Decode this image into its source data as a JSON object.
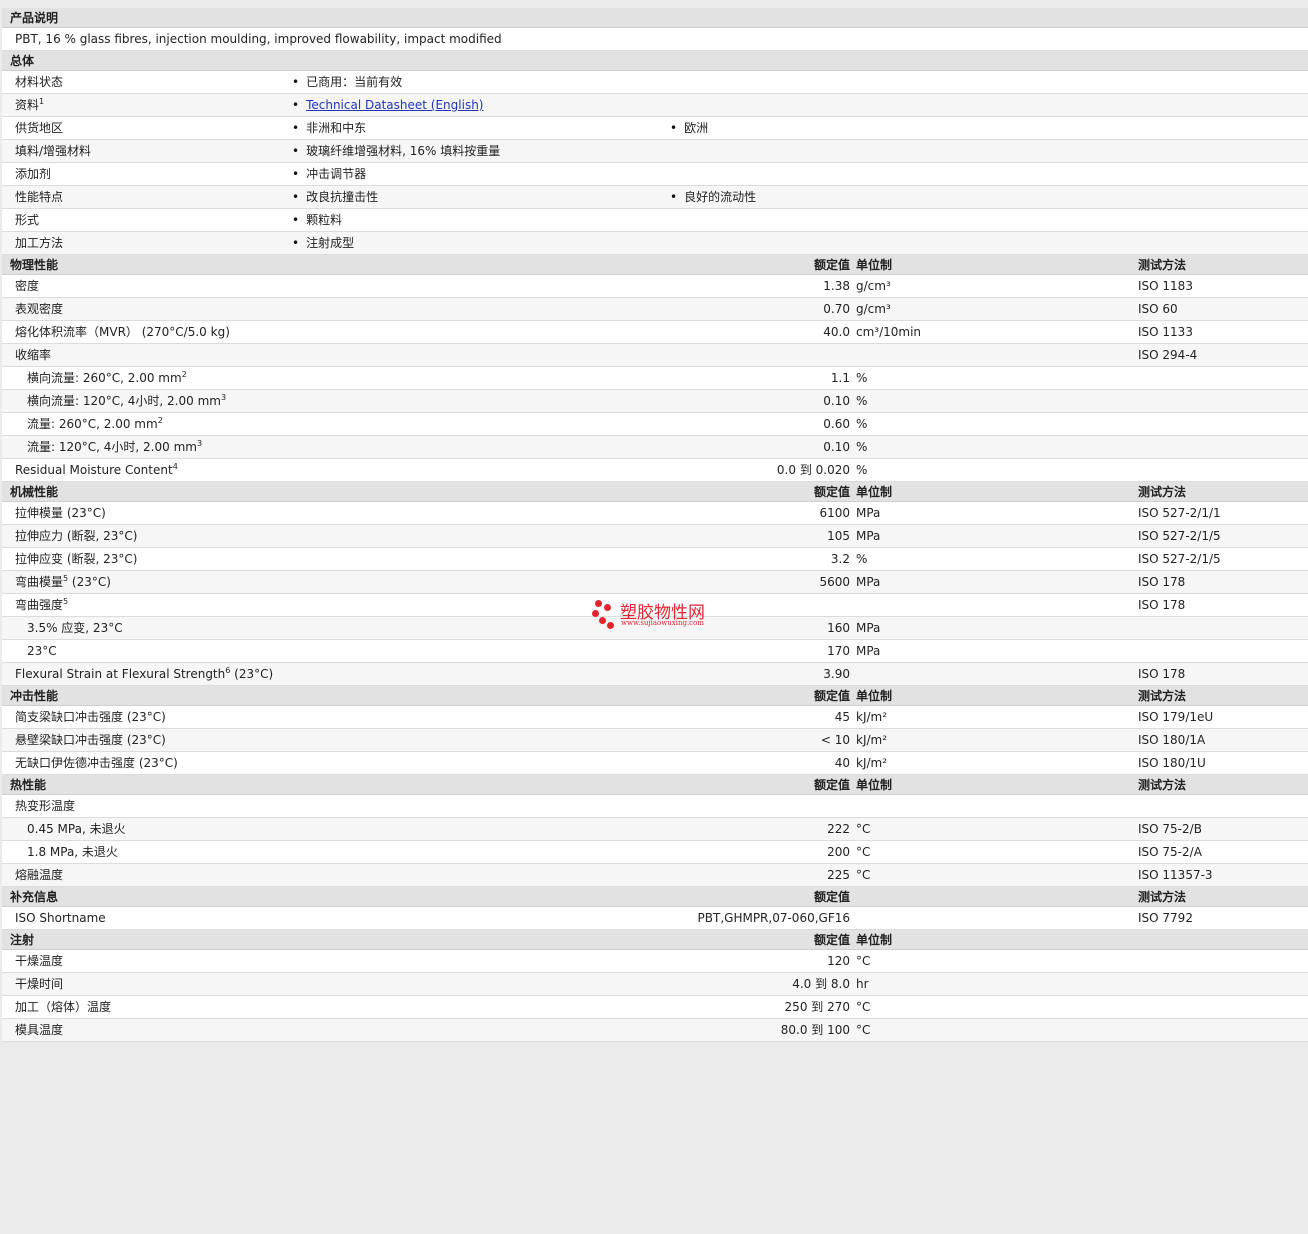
{
  "desc": {
    "title": "产品说明",
    "text": "PBT, 16 % glass fibres, injection moulding, improved flowability, impact modified"
  },
  "general": {
    "title": "总体",
    "rows": [
      {
        "label": "材料状态",
        "b1": "已商用：当前有效"
      },
      {
        "label": "资料",
        "sup": "1",
        "b1": "Technical Datasheet (English)",
        "link": true
      },
      {
        "label": "供货地区",
        "b1": "非洲和中东",
        "b2": "欧洲"
      },
      {
        "label": "填料/增强材料",
        "b1": "玻璃纤维增强材料, 16% 填料按重量"
      },
      {
        "label": "添加剂",
        "b1": "冲击调节器"
      },
      {
        "label": "性能特点",
        "b1": "改良抗撞击性",
        "b2": "良好的流动性"
      },
      {
        "label": "形式",
        "b1": "颗粒料"
      },
      {
        "label": "加工方法",
        "b1": "注射成型"
      }
    ]
  },
  "physical": {
    "title": "物理性能",
    "h_value": "额定值",
    "h_unit": "单位制",
    "h_method": "测试方法",
    "rows": [
      {
        "label": "密度",
        "value": "1.38",
        "unit": "g/cm³",
        "method": "ISO 1183"
      },
      {
        "label": "表观密度",
        "value": "0.70",
        "unit": "g/cm³",
        "method": "ISO 60"
      },
      {
        "label": "熔化体积流率（MVR） (270°C/5.0 kg)",
        "value": "40.0",
        "unit": "cm³/10min",
        "method": "ISO 1133"
      },
      {
        "label": "收缩率",
        "method": "ISO 294-4"
      },
      {
        "label": "横向流量: 260°C, 2.00 mm",
        "sup": "2",
        "sub": true,
        "value": "1.1",
        "unit": "%"
      },
      {
        "label": "横向流量: 120°C, 4小时, 2.00 mm",
        "sup": "3",
        "sub": true,
        "value": "0.10",
        "unit": "%"
      },
      {
        "label": "流量: 260°C, 2.00 mm",
        "sup": "2",
        "sub": true,
        "value": "0.60",
        "unit": "%"
      },
      {
        "label": "流量: 120°C, 4小时, 2.00 mm",
        "sup": "3",
        "sub": true,
        "value": "0.10",
        "unit": "%"
      },
      {
        "label": "Residual Moisture Content",
        "sup": "4",
        "value": "0.0 到  0.020",
        "unit": "%"
      }
    ]
  },
  "mechanical": {
    "title": "机械性能",
    "h_value": "额定值",
    "h_unit": "单位制",
    "h_method": "测试方法",
    "rows": [
      {
        "label": "拉伸模量 (23°C)",
        "value": "6100",
        "unit": "MPa",
        "method": "ISO 527-2/1/1"
      },
      {
        "label": "拉伸应力 (断裂, 23°C)",
        "value": "105",
        "unit": "MPa",
        "method": "ISO 527-2/1/5"
      },
      {
        "label": "拉伸应变 (断裂, 23°C)",
        "value": "3.2",
        "unit": "%",
        "method": "ISO 527-2/1/5"
      },
      {
        "label": "弯曲模量",
        "sup": "5",
        "suffix": " (23°C)",
        "value": "5600",
        "unit": "MPa",
        "method": "ISO 178"
      },
      {
        "label": "弯曲强度",
        "sup": "5",
        "method": "ISO 178"
      },
      {
        "label": "3.5% 应变, 23°C",
        "sub": true,
        "value": "160",
        "unit": "MPa"
      },
      {
        "label": "23°C",
        "sub": true,
        "value": "170",
        "unit": "MPa"
      },
      {
        "label": "Flexural Strain at Flexural Strength",
        "sup": "6",
        "suffix": " (23°C)",
        "value": "3.90",
        "method": "ISO 178"
      }
    ]
  },
  "impact": {
    "title": "冲击性能",
    "h_value": "额定值",
    "h_unit": "单位制",
    "h_method": "测试方法",
    "rows": [
      {
        "label": "简支梁缺口冲击强度 (23°C)",
        "value": "45",
        "unit": "kJ/m²",
        "method": "ISO 179/1eU"
      },
      {
        "label": "悬壁梁缺口冲击强度 (23°C)",
        "value": "< 10",
        "unit": "kJ/m²",
        "method": "ISO 180/1A"
      },
      {
        "label": "无缺口伊佐德冲击强度 (23°C)",
        "value": "40",
        "unit": "kJ/m²",
        "method": "ISO 180/1U"
      }
    ]
  },
  "thermal": {
    "title": "热性能",
    "h_value": "额定值",
    "h_unit": "单位制",
    "h_method": "测试方法",
    "rows": [
      {
        "label": "热变形温度"
      },
      {
        "label": "0.45 MPa, 未退火",
        "sub": true,
        "value": "222",
        "unit": "°C",
        "method": "ISO 75-2/B"
      },
      {
        "label": "1.8 MPa, 未退火",
        "sub": true,
        "value": "200",
        "unit": "°C",
        "method": "ISO 75-2/A"
      },
      {
        "label": "熔融温度",
        "value": "225",
        "unit": "°C",
        "method": "ISO 11357-3"
      }
    ]
  },
  "supplement": {
    "title": "补充信息",
    "h_value": "额定值",
    "h_method": "测试方法",
    "rows": [
      {
        "label": "ISO Shortname",
        "value": "PBT,GHMPR,07-060,GF16",
        "method": "ISO 7792"
      }
    ]
  },
  "injection": {
    "title": "注射",
    "h_value": "额定值",
    "h_unit": "单位制",
    "rows": [
      {
        "label": "干燥温度",
        "value": "120",
        "unit": "°C"
      },
      {
        "label": "干燥时间",
        "value": "4.0 到  8.0",
        "unit": "hr"
      },
      {
        "label": "加工（熔体）温度",
        "value": "250 到  270",
        "unit": "°C"
      },
      {
        "label": "模具温度",
        "value": "80.0 到  100",
        "unit": "°C"
      }
    ]
  },
  "watermark": {
    "text": "塑胶物性网",
    "url": "www.sujiaowuxing.com",
    "color": "#e2252f"
  }
}
